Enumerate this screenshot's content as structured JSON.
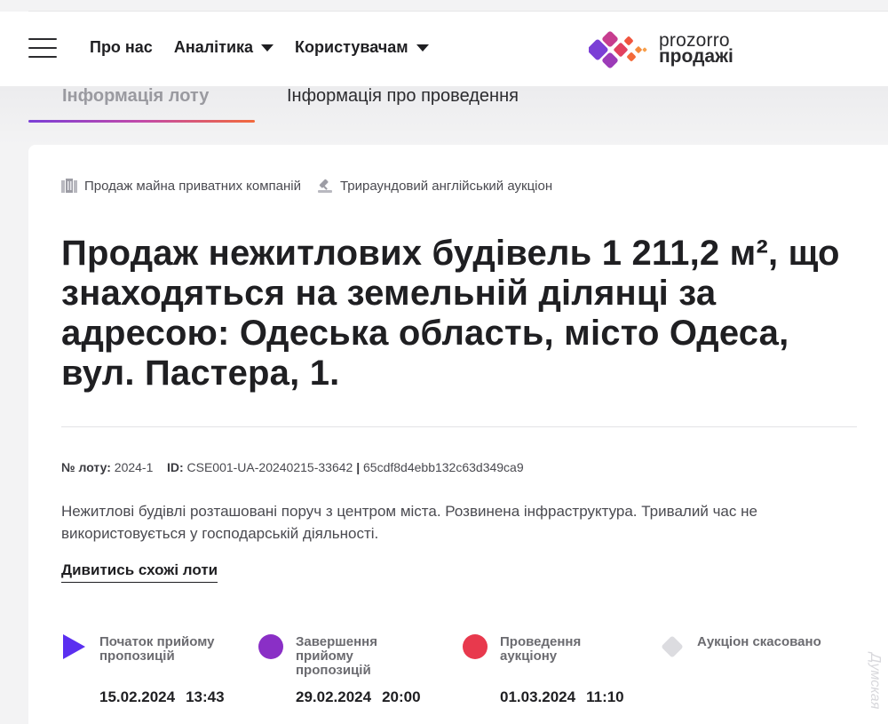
{
  "header": {
    "nav": [
      {
        "label": "Про нас",
        "dropdown": false
      },
      {
        "label": "Аналітика",
        "dropdown": true
      },
      {
        "label": "Користувачам",
        "dropdown": true
      }
    ],
    "logo": {
      "line1": "prozorro",
      "line2": "продажі"
    }
  },
  "tabs": [
    {
      "label": "Інформація лоту",
      "active": true
    },
    {
      "label": "Інформація про проведення",
      "active": false
    }
  ],
  "lot": {
    "tags": [
      {
        "icon": "building-icon",
        "label": "Продаж майна приватних компаній"
      },
      {
        "icon": "gavel-icon",
        "label": "Трираундовий англійський аукціон"
      }
    ],
    "title": "Продаж нежитлових будівель 1 211,2 м², що знаходяться на земельній ділянці за адресою: Одеська область, місто Одеса, вул. Пастера, 1.",
    "meta": {
      "lot_label": "№ лоту:",
      "lot_value": "2024-1",
      "id_label": "ID:",
      "id_value": "CSE001-UA-20240215-33642",
      "separator": "|",
      "hash": "65cdf8d4ebb132c63d349ca9"
    },
    "description": "Нежитлові будівлі розташовані поруч з центром міста. Розвинена інфраструктура. Тривалий час не використовується у господарській діяльності.",
    "similar_link": "Дивитись схожі лоти"
  },
  "timeline": [
    {
      "label": "Початок прийому пропозицій",
      "date": "15.02.2024",
      "time": "13:43",
      "icon": "play-icon",
      "color": "#5b2ff0"
    },
    {
      "label": "Завершення прийому пропозицій",
      "date": "29.02.2024",
      "time": "20:00",
      "icon": "circle-icon",
      "color": "#8a2fc6"
    },
    {
      "label": "Проведення аукціону",
      "date": "01.03.2024",
      "time": "11:10",
      "icon": "circle-icon",
      "color": "#e8394d"
    },
    {
      "label": "Аукціон скасовано",
      "date": "",
      "time": "",
      "icon": "diamond-icon",
      "color": "#dcdce0"
    }
  ],
  "watermark": "Думская"
}
